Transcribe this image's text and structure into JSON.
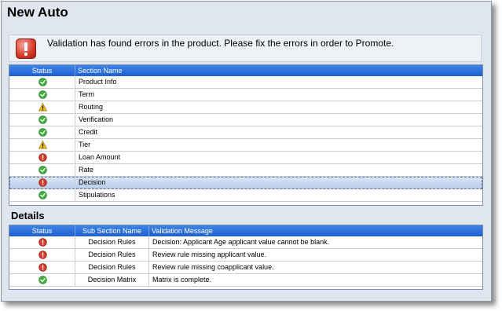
{
  "window": {
    "title": "New Auto"
  },
  "alert": {
    "icon": "error-icon",
    "message": "Validation has found errors in the product.  Please fix the errors in order to Promote."
  },
  "sections_grid": {
    "columns": [
      "Status",
      "Section Name"
    ],
    "rows": [
      {
        "status": "ok",
        "name": "Product Info"
      },
      {
        "status": "ok",
        "name": "Term"
      },
      {
        "status": "warning",
        "name": "Routing"
      },
      {
        "status": "ok",
        "name": "Verification"
      },
      {
        "status": "ok",
        "name": "Credit"
      },
      {
        "status": "warning",
        "name": "Tier"
      },
      {
        "status": "error",
        "name": "Loan Amount"
      },
      {
        "status": "ok",
        "name": "Rate"
      },
      {
        "status": "error",
        "name": "Decision",
        "selected": true
      },
      {
        "status": "ok",
        "name": "Stipulations"
      }
    ]
  },
  "details": {
    "title": "Details",
    "columns": [
      "Status",
      "Sub Section Name",
      "Validation Message"
    ],
    "rows": [
      {
        "status": "error",
        "sub_section": "Decision Rules",
        "message": "Decision: Applicant Age applicant value cannot be blank."
      },
      {
        "status": "error",
        "sub_section": "Decision Rules",
        "message": "Review rule missing applicant value."
      },
      {
        "status": "error",
        "sub_section": "Decision Rules",
        "message": "Review rule missing coapplicant value."
      },
      {
        "status": "ok",
        "sub_section": "Decision Matrix",
        "message": "Matrix is complete."
      }
    ]
  },
  "colors": {
    "header_blue": "#2a6ddc",
    "ok_green": "#3fae3a",
    "warning_yellow": "#f2c21b",
    "error_red": "#d63a27"
  }
}
